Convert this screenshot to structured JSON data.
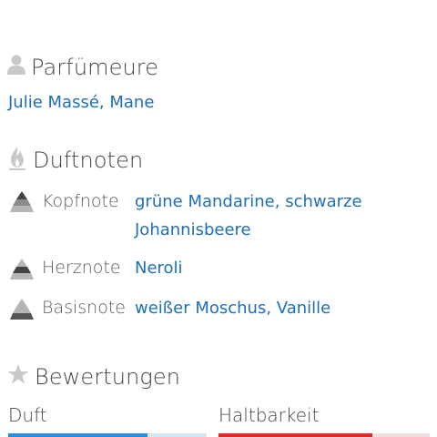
{
  "perfumers": {
    "heading": "Parfümeure",
    "names": "Julie Massé, Mane"
  },
  "notes": {
    "heading": "Duftnoten",
    "items": [
      {
        "label": "Kopfnote",
        "value": "grüne Mandarine, schwarze Johannisbeere"
      },
      {
        "label": "Herznote",
        "value": "Neroli"
      },
      {
        "label": "Basisnote",
        "value": "weißer Moschus, Vanille"
      }
    ]
  },
  "ratings": {
    "heading": "Bewertungen",
    "items": [
      {
        "label": "Duft",
        "fill_fraction": 0.7,
        "fill_color": "#2a8ee0",
        "track_color": "#d9e7f3"
      },
      {
        "label": "Haltbarkeit",
        "fill_fraction": 0.73,
        "fill_color": "#e02a2a",
        "track_color": "#f3dddd"
      }
    ]
  },
  "colors": {
    "link": "#1f6fb4",
    "heading": "#454545",
    "icon": "#c9c9c9"
  },
  "icons": {
    "perfumers": "person-icon",
    "notes": "flame-icon",
    "ratings": "star-icon",
    "note_row": "pyramid-icon"
  }
}
